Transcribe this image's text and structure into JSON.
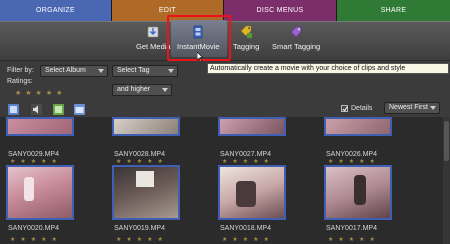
{
  "tabs": [
    {
      "label": "ORGANIZE",
      "color": "#4a67b3"
    },
    {
      "label": "EDIT",
      "color": "#b06a28"
    },
    {
      "label": "DISC MENUS",
      "color": "#7c2e6a"
    },
    {
      "label": "SHARE",
      "color": "#2f7a34"
    }
  ],
  "toolbar": {
    "get_media": "Get Media",
    "instant_movie": "InstantMovie",
    "tagging": "Tagging",
    "smart_tagging": "Smart Tagging",
    "highlight_color": "#e8141a"
  },
  "tooltip": "Automatically create a movie with your choice of clips and style",
  "filters": {
    "filter_by_label": "Filter by:",
    "album_select": "Select Album",
    "tag_select": "Select Tag",
    "ratings_label": "Ratings:",
    "rating_stars": 0,
    "rating_condition": "and higher"
  },
  "view": {
    "details_label": "Details",
    "details_checked": true,
    "sort": "Newest First"
  },
  "clips_row1": [
    {
      "name": "SANY0029.MP4"
    },
    {
      "name": "SANY0028.MP4"
    },
    {
      "name": "SANY0027.MP4"
    },
    {
      "name": "SANY0026.MP4"
    }
  ],
  "clips_row2": [
    {
      "name": "SANY0020.MP4"
    },
    {
      "name": "SANY0019.MP4"
    },
    {
      "name": "SANY0018.MP4"
    },
    {
      "name": "SANY0017.MP4"
    }
  ]
}
